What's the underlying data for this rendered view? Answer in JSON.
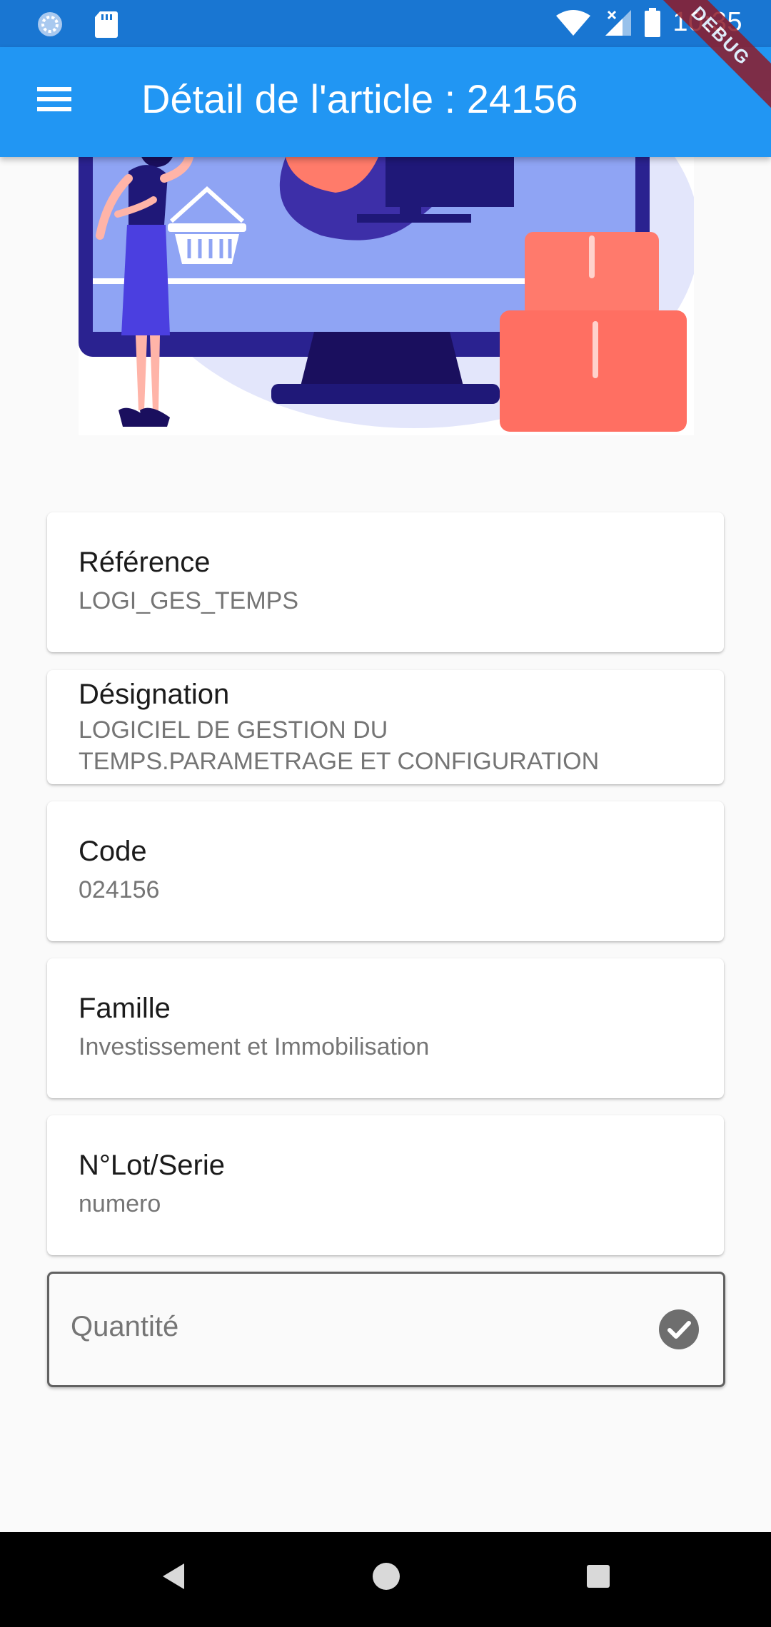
{
  "status_bar": {
    "time": "10:35",
    "icons": [
      "spinner-icon",
      "sd-card-icon",
      "wifi-icon",
      "signal-icon",
      "battery-icon"
    ]
  },
  "app_bar": {
    "title": "Détail de l'article : 24156",
    "menu_icon": "menu-icon",
    "debug_banner": "DEBUG"
  },
  "colors": {
    "app_bar": "#2196f3",
    "status_bar": "#1976d2",
    "background": "#fafafa"
  },
  "details": [
    {
      "label": "Référence",
      "value": "LOGI_GES_TEMPS"
    },
    {
      "label": "Désignation",
      "value_lines": [
        "LOGICIEL DE GESTION DU",
        "TEMPS.PARAMETRAGE ET CONFIGURATION"
      ]
    },
    {
      "label": "Code",
      "value": "024156"
    },
    {
      "label": "Famille",
      "value": "Investissement et Immobilisation"
    },
    {
      "label": "N°Lot/Serie",
      "value": "numero"
    }
  ],
  "quantity_field": {
    "placeholder": "Quantité",
    "icon": "check-circle-icon"
  },
  "nav_bar": {
    "buttons": [
      "back-icon",
      "home-icon",
      "recents-icon"
    ]
  }
}
